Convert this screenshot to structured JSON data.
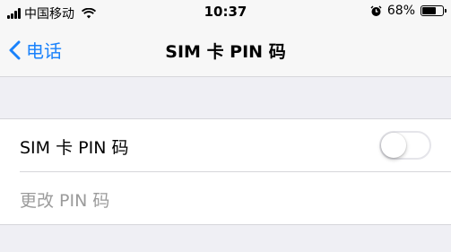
{
  "status_bar": {
    "carrier": "中国移动",
    "time": "10:37",
    "battery_percent": "68%",
    "battery_level": 0.68,
    "icons": [
      "signal-icon",
      "wifi-icon",
      "alarm-icon",
      "battery-icon"
    ]
  },
  "nav": {
    "back_label": "电话",
    "title": "SIM 卡 PIN 码"
  },
  "settings": {
    "sim_pin_label": "SIM 卡 PIN 码",
    "sim_pin_enabled": false,
    "change_pin_label": "更改 PIN 码"
  },
  "colors": {
    "accent": "#1a82fb",
    "background": "#efeff4",
    "disabled_text": "#9b9b9b"
  }
}
